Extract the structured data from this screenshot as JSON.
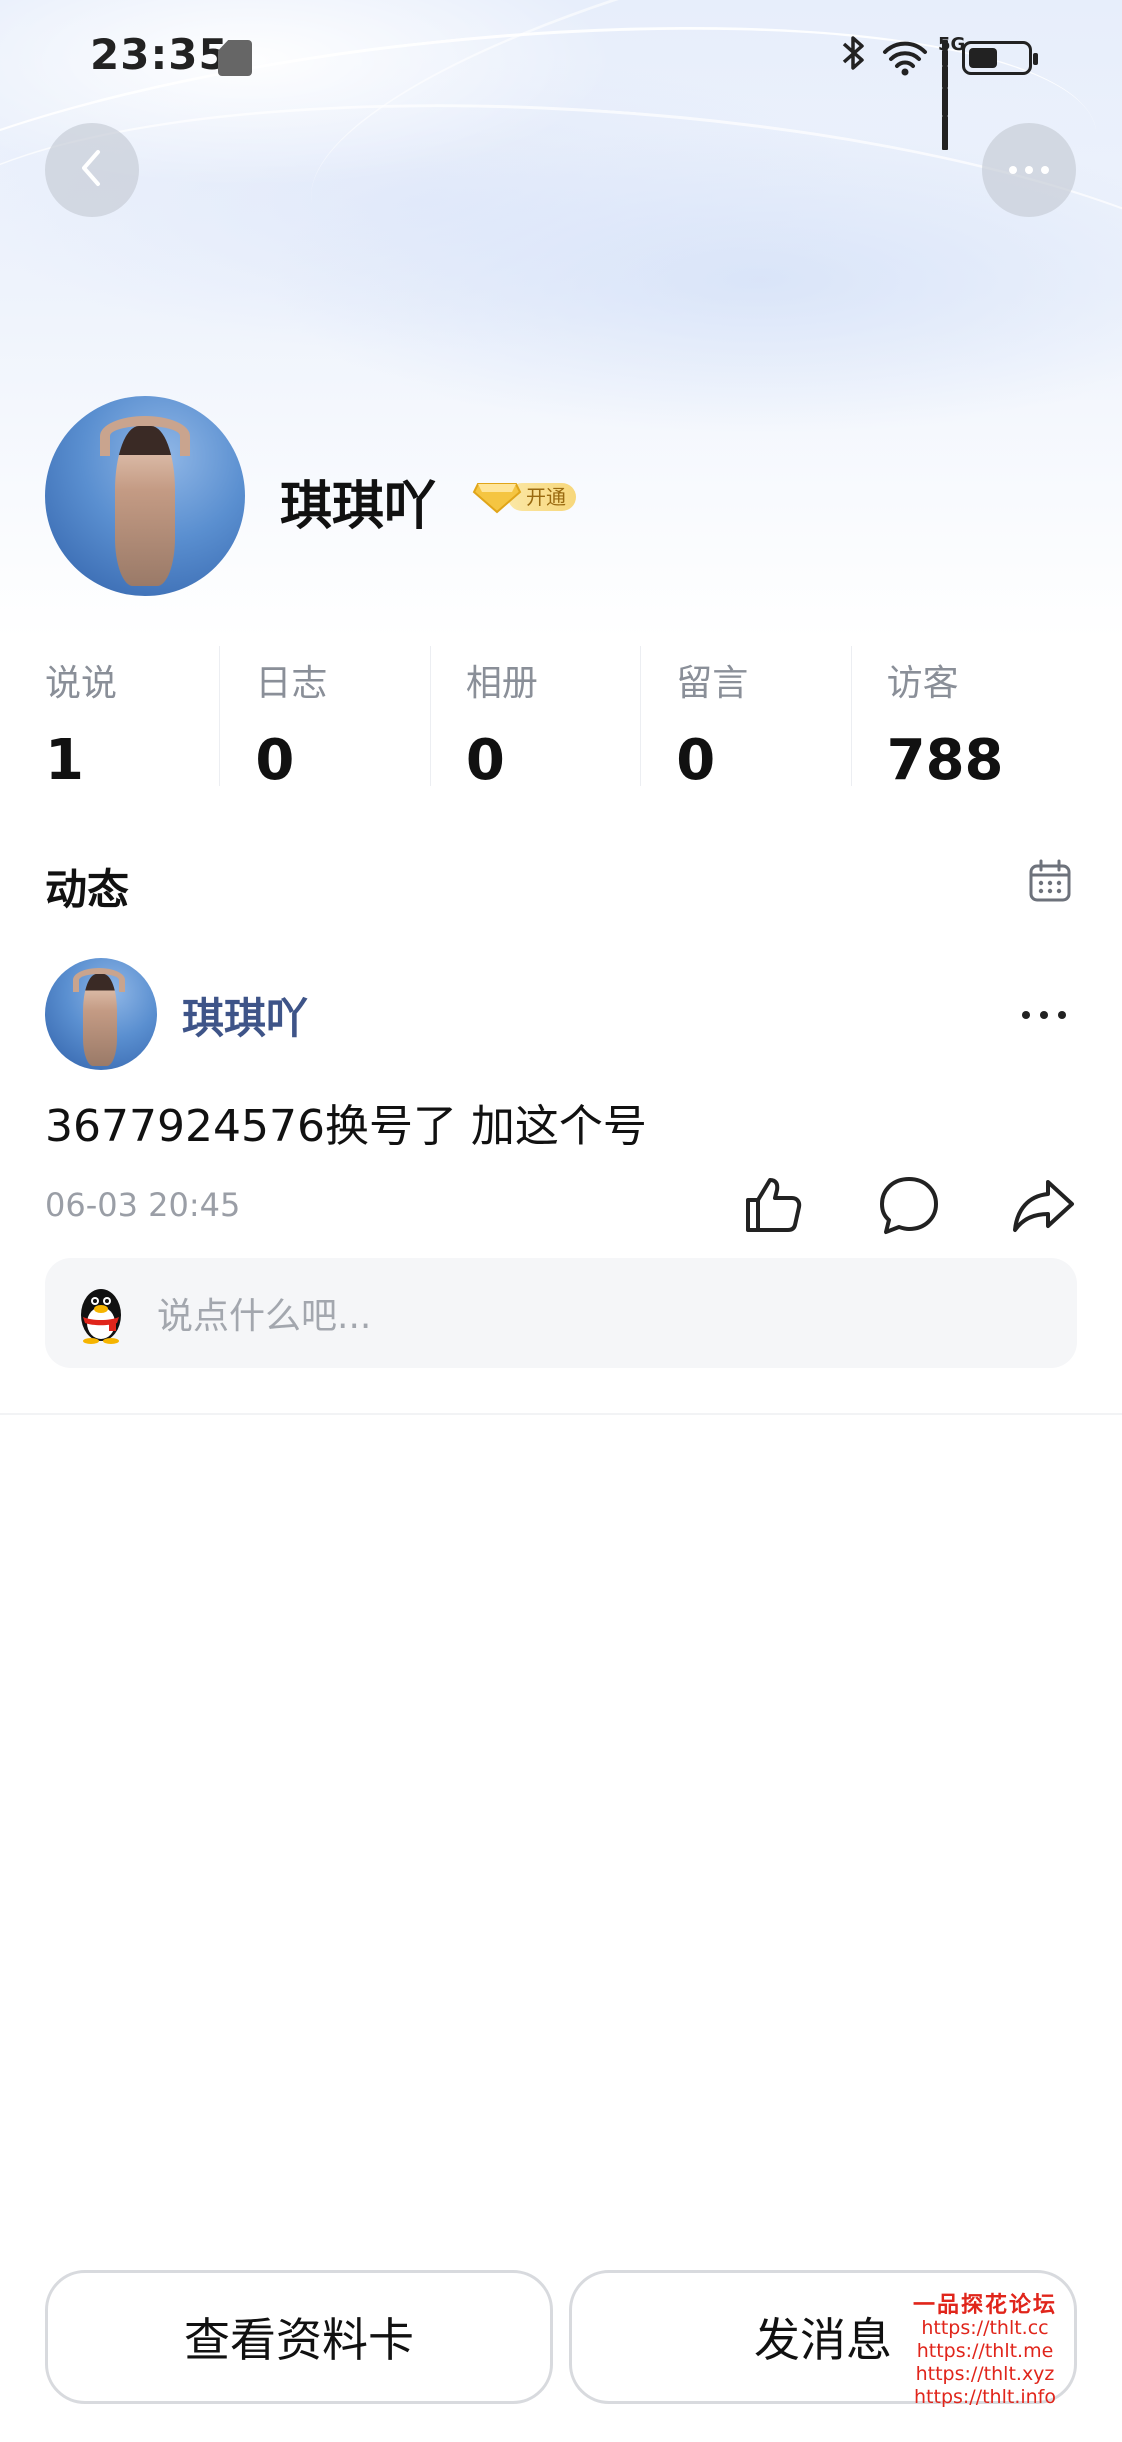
{
  "status_bar": {
    "time": "23:35",
    "network": "5G",
    "icons": [
      "sim-icon",
      "bluetooth-icon",
      "wifi-icon",
      "signal-icon",
      "battery-icon"
    ]
  },
  "header": {
    "back_icon": "chevron-left-icon",
    "more_icon": "more-horizontal-icon"
  },
  "profile": {
    "name": "琪琪吖",
    "vip_label": "开通"
  },
  "stats": [
    {
      "label": "说说",
      "value": "1"
    },
    {
      "label": "日志",
      "value": "0"
    },
    {
      "label": "相册",
      "value": "0"
    },
    {
      "label": "留言",
      "value": "0"
    },
    {
      "label": "访客",
      "value": "788"
    }
  ],
  "feed": {
    "title": "动态",
    "post": {
      "author": "琪琪吖",
      "text": "3677924576换号了 加这个号",
      "time": "06-03 20:45"
    },
    "comment_placeholder": "说点什么吧..."
  },
  "actions": {
    "profile_card": "查看资料卡",
    "send_message": "发消息"
  },
  "watermark": {
    "title": "一品探花论坛",
    "lines": [
      "https://thlt.cc",
      "https://thlt.me",
      "https://thlt.xyz",
      "https://thlt.info"
    ]
  },
  "colors": {
    "accent_name": "#3e5488",
    "vip_gold": "#f7d77b",
    "watermark": "#e0251b"
  }
}
